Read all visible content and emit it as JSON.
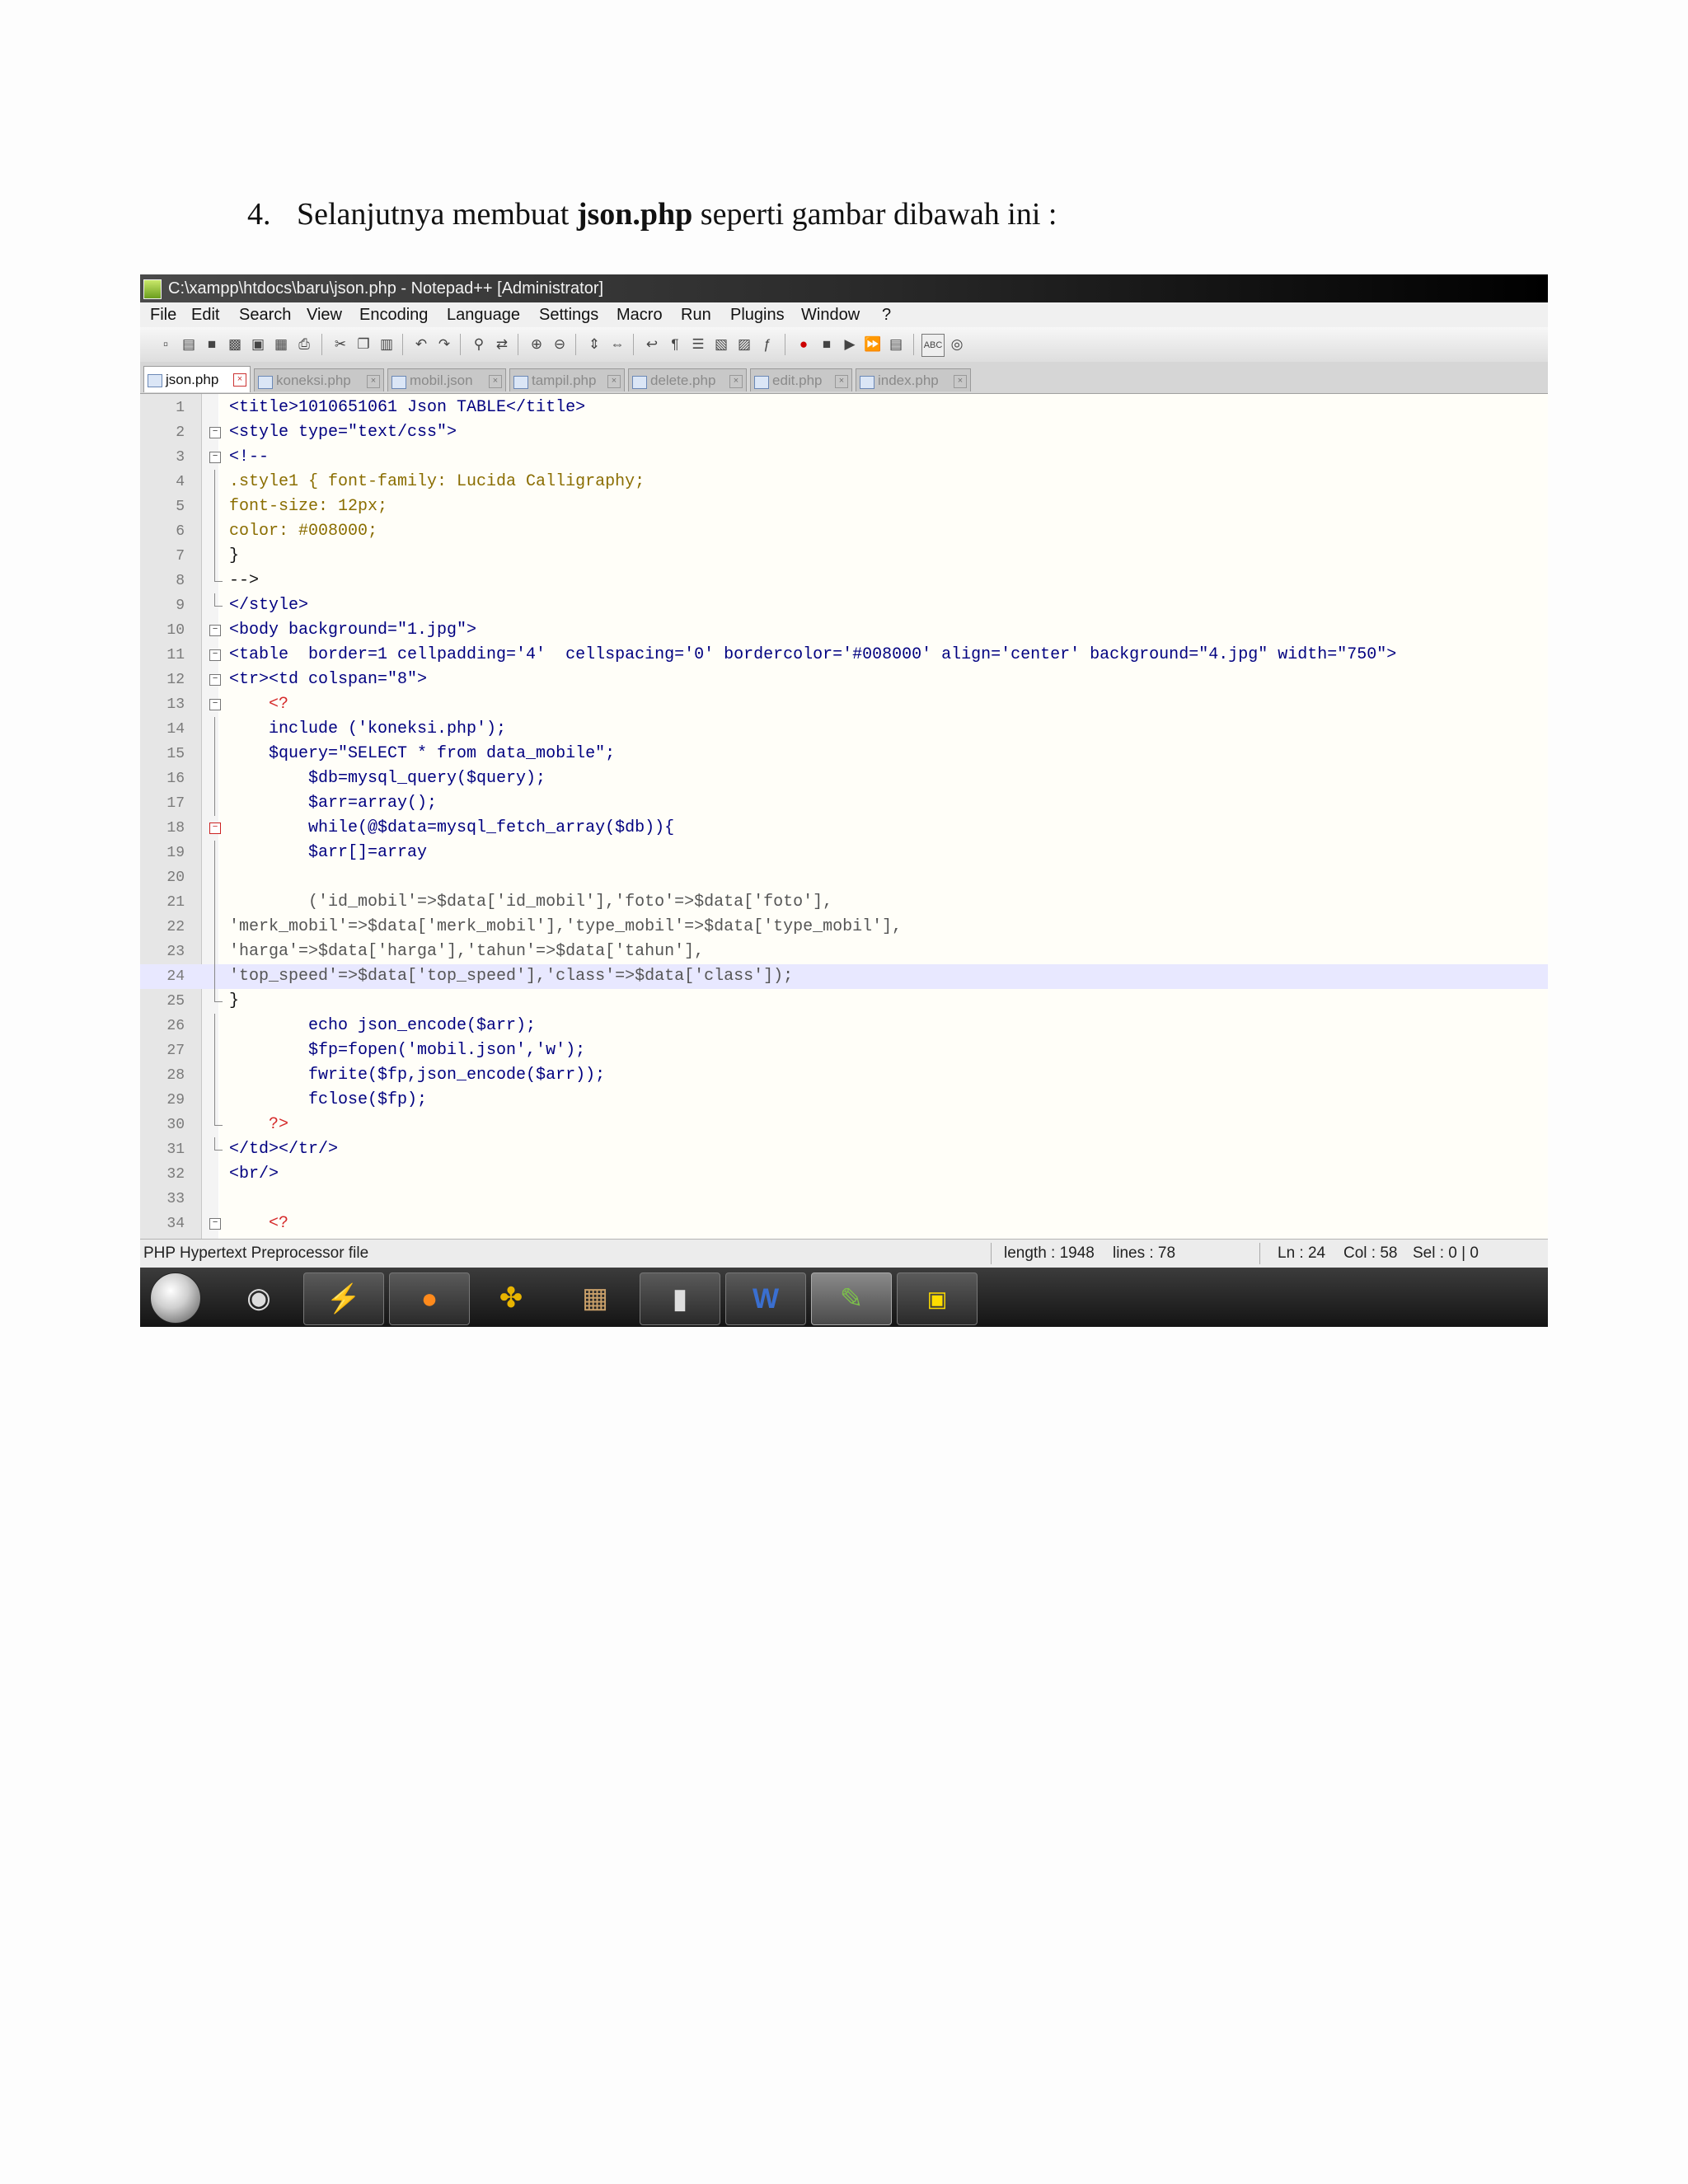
{
  "document": {
    "heading_number": "4.",
    "heading_before": "Selanjutnya membuat ",
    "heading_bold": "json.php",
    "heading_after": " seperti gambar dibawah ini :"
  },
  "window": {
    "title": "C:\\xampp\\htdocs\\baru\\json.php - Notepad++ [Administrator]"
  },
  "menu": [
    "File",
    "Edit",
    "Search",
    "View",
    "Encoding",
    "Language",
    "Settings",
    "Macro",
    "Run",
    "Plugins",
    "Window",
    "?"
  ],
  "toolbar_icons": [
    "new-file-icon",
    "open-file-icon",
    "save-icon",
    "save-all-icon",
    "close-icon",
    "close-all-icon",
    "print-icon",
    "cut-icon",
    "copy-icon",
    "paste-icon",
    "undo-icon",
    "redo-icon",
    "find-icon",
    "replace-icon",
    "zoom-in-icon",
    "zoom-out-icon",
    "sync-vertical-icon",
    "sync-horizontal-icon",
    "word-wrap-icon",
    "show-all-characters-icon",
    "indent-guide-icon",
    "user-defined-language-icon",
    "doc-map-icon",
    "function-list-icon",
    "record-macro-icon",
    "stop-record-icon",
    "play-macro-icon",
    "run-macro-multiple-icon",
    "save-macro-icon",
    "spell-check-icon",
    "plugin-icon"
  ],
  "tabs": [
    {
      "label": "json.php",
      "active": true
    },
    {
      "label": "koneksi.php",
      "active": false
    },
    {
      "label": "mobil.json",
      "active": false
    },
    {
      "label": "tampil.php",
      "active": false
    },
    {
      "label": "delete.php",
      "active": false
    },
    {
      "label": "edit.php",
      "active": false
    },
    {
      "label": "index.php",
      "active": false
    }
  ],
  "code_lines": [
    {
      "n": "1",
      "text": "<title>1010651061 Json TABLE</title>"
    },
    {
      "n": "2",
      "text": "<style type=\"text/css\">"
    },
    {
      "n": "3",
      "text": "<!--"
    },
    {
      "n": "4",
      "text": ".style1 { font-family: Lucida Calligraphy;"
    },
    {
      "n": "5",
      "text": "font-size: 12px;"
    },
    {
      "n": "6",
      "text": "color: #008000;"
    },
    {
      "n": "7",
      "text": "}"
    },
    {
      "n": "8",
      "text": "-->"
    },
    {
      "n": "9",
      "text": "</style>"
    },
    {
      "n": "10",
      "text": "<body background=\"1.jpg\">"
    },
    {
      "n": "11",
      "text": "<table  border=1 cellpadding='4'  cellspacing='0' bordercolor='#008000' align='center' background=\"4.jpg\" width=\"750\">"
    },
    {
      "n": "12",
      "text": "<tr><td colspan=\"8\">"
    },
    {
      "n": "13",
      "text": "    <?"
    },
    {
      "n": "14",
      "text": "    include ('koneksi.php');"
    },
    {
      "n": "15",
      "text": "    $query=\"SELECT * from data_mobile\";"
    },
    {
      "n": "16",
      "text": "        $db=mysql_query($query);"
    },
    {
      "n": "17",
      "text": "        $arr=array();"
    },
    {
      "n": "18",
      "text": "        while(@$data=mysql_fetch_array($db)){"
    },
    {
      "n": "19",
      "text": "        $arr[]=array"
    },
    {
      "n": "20",
      "text": ""
    },
    {
      "n": "21",
      "text": "        ('id_mobil'=>$data['id_mobil'],'foto'=>$data['foto'],"
    },
    {
      "n": "22",
      "text": "'merk_mobil'=>$data['merk_mobil'],'type_mobil'=>$data['type_mobil'],"
    },
    {
      "n": "23",
      "text": "'harga'=>$data['harga'],'tahun'=>$data['tahun'],"
    },
    {
      "n": "24",
      "text": "'top_speed'=>$data['top_speed'],'class'=>$data['class']);"
    },
    {
      "n": "25",
      "text": "}"
    },
    {
      "n": "26",
      "text": "        echo json_encode($arr);"
    },
    {
      "n": "27",
      "text": "        $fp=fopen('mobil.json','w');"
    },
    {
      "n": "28",
      "text": "        fwrite($fp,json_encode($arr));"
    },
    {
      "n": "29",
      "text": "        fclose($fp);"
    },
    {
      "n": "30",
      "text": "    ?>"
    },
    {
      "n": "31",
      "text": "</td></tr/>"
    },
    {
      "n": "32",
      "text": "<br/>"
    },
    {
      "n": "33",
      "text": ""
    },
    {
      "n": "34",
      "text": "    <?"
    }
  ],
  "status": {
    "file_type": "PHP Hypertext Preprocessor file",
    "length": "length : 1948",
    "lines": "lines : 78",
    "ln": "Ln : 24",
    "col": "Col : 58",
    "sel": "Sel : 0 | 0"
  },
  "taskbar_items": [
    "media-player-icon",
    "winamp-icon",
    "firefox-icon",
    "messenger-icon",
    "movie-maker-icon",
    "computer-icon",
    "word-icon",
    "notepadpp-icon",
    "counter-icon"
  ],
  "colors": {
    "tag": "#000080",
    "attr": "#d52a2a",
    "string": "#8000ff",
    "keyword": "#000080",
    "php_string": "#808080",
    "variable": "#000080"
  }
}
